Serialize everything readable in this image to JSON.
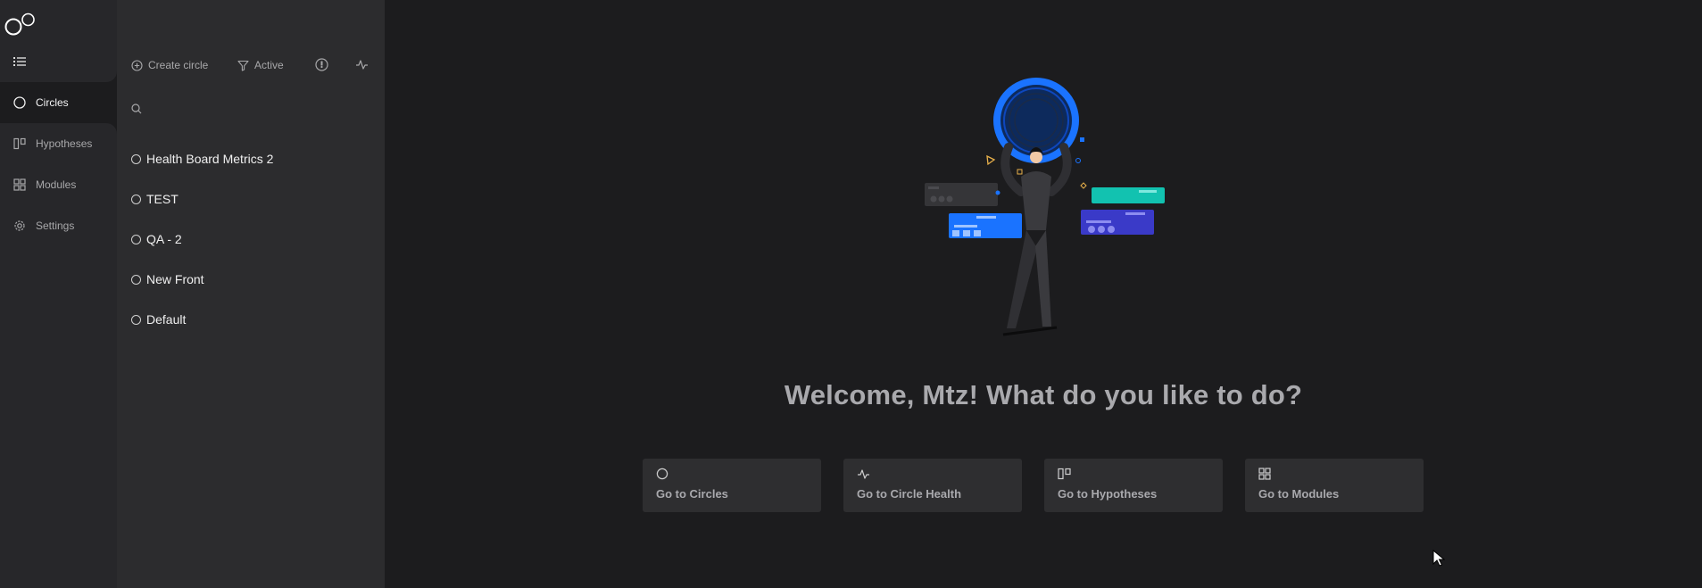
{
  "nav": {
    "items": [
      {
        "label": "Circles",
        "icon": "circle-icon",
        "active": true
      },
      {
        "label": "Hypotheses",
        "icon": "hypotheses-icon",
        "active": false
      },
      {
        "label": "Modules",
        "icon": "modules-icon",
        "active": false
      },
      {
        "label": "Settings",
        "icon": "gear-icon",
        "active": false
      }
    ]
  },
  "panel": {
    "toolbar": {
      "create_label": "Create circle",
      "filter_label": "Active"
    },
    "search": {
      "placeholder": "",
      "value": ""
    },
    "circles": [
      "Health Board Metrics 2",
      "TEST",
      "QA - 2",
      "New Front",
      "Default"
    ]
  },
  "main": {
    "welcome": "Welcome, Mtz! What do you like to do?",
    "actions": [
      {
        "label": "Go to Circles",
        "icon": "circle-icon"
      },
      {
        "label": "Go to Circle Health",
        "icon": "pulse-icon"
      },
      {
        "label": "Go to Hypotheses",
        "icon": "hypotheses-icon"
      },
      {
        "label": "Go to Modules",
        "icon": "modules-icon"
      }
    ]
  },
  "colors": {
    "background": "#1c1c1e",
    "nav_block": "#27272a",
    "panel": "#2c2c2e",
    "card": "#2e2e30",
    "accent_blue": "#1a73ff",
    "accent_teal": "#12c2b0",
    "accent_indigo": "#3a3ac8"
  }
}
